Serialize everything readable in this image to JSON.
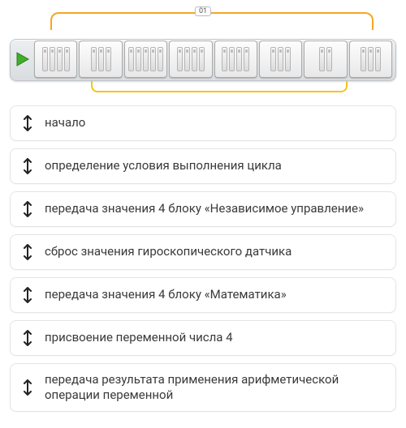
{
  "diagram": {
    "counter": "01",
    "blocks": [
      {
        "name": "play-start",
        "color": "green",
        "tab": null
      },
      {
        "name": "block-motor-1",
        "color": "yellow",
        "tab": "t-y"
      },
      {
        "name": "block-var-1",
        "color": "red",
        "tab": "t-r"
      },
      {
        "name": "block-motor-2",
        "color": "green",
        "tab": "t-g"
      },
      {
        "name": "block-gyro",
        "color": "yellow",
        "tab": "t-y"
      },
      {
        "name": "block-math",
        "color": "red",
        "tab": "t-r"
      },
      {
        "name": "block-var-2",
        "color": "red",
        "tab": "t-r"
      },
      {
        "name": "block-compare",
        "color": "orange",
        "tab": "t-o"
      },
      {
        "name": "block-loop-end",
        "color": "orange",
        "tab": "t-o"
      }
    ]
  },
  "items": [
    {
      "label": "начало"
    },
    {
      "label": "определение условия выполнения цикла"
    },
    {
      "label": "передача значения 4 блоку «Независимое управление»"
    },
    {
      "label": "сброс значения гироскопического датчика"
    },
    {
      "label": "передача значения 4 блоку «Математика»"
    },
    {
      "label": "присвоение переменной числа 4"
    },
    {
      "label": "передача результата применения арифметической операции переменной"
    }
  ]
}
